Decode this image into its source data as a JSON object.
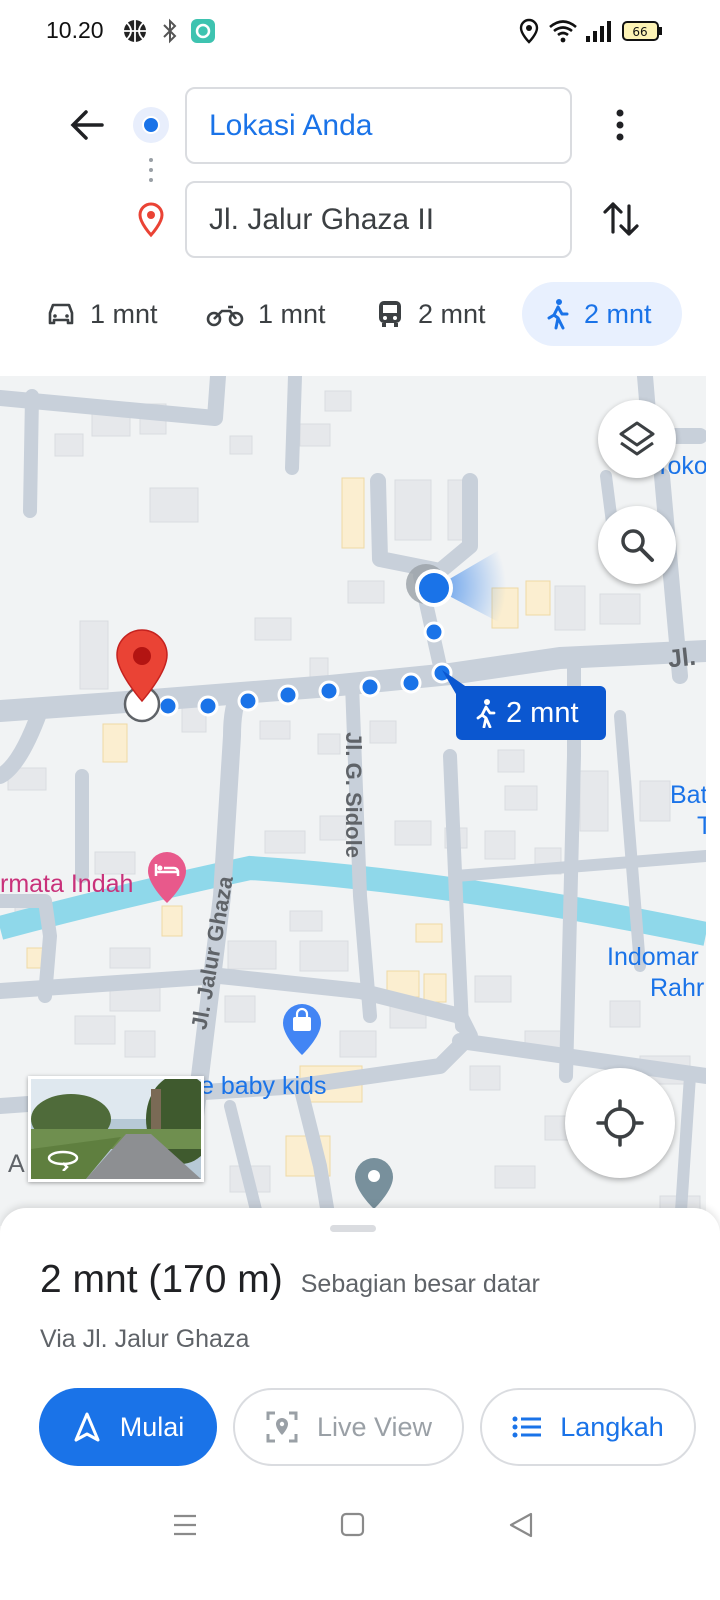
{
  "status_bar": {
    "time": "10.20",
    "battery": "66",
    "left_icons": [
      "basketball-icon",
      "bluetooth-icon",
      "app-notification-icon"
    ],
    "right_icons": [
      "location-icon",
      "wifi-icon",
      "signal-icon",
      "battery-icon"
    ]
  },
  "directions": {
    "origin": "Lokasi Anda",
    "destination": "Jl. Jalur Ghaza II"
  },
  "modes": [
    {
      "icon": "car-icon",
      "time": "1 mnt"
    },
    {
      "icon": "motorcycle-icon",
      "time": "1 mnt"
    },
    {
      "icon": "transit-icon",
      "time": "2 mnt"
    },
    {
      "icon": "walk-icon",
      "time": "2 mnt",
      "selected": true
    }
  ],
  "map": {
    "route_badge": "2 mnt",
    "labels": {
      "toko": "Toko",
      "jl_right": "Jl.",
      "jl_g_sidole": "Jl. G. Sidole",
      "jl_jalur_ghaza": "Jl. Jalur Ghaza",
      "permata_indah": "rmata Indah",
      "bat": "Bat",
      "t": "T",
      "indomaret": "Indomar",
      "rahm": "Rahr",
      "baby_kids": "e baby kids",
      "a": "A"
    }
  },
  "sheet": {
    "summary_main": "2 mnt (170 m)",
    "summary_note": "Sebagian besar datar",
    "via": "Via Jl. Jalur Ghaza",
    "start_label": "Mulai",
    "live_view_label": "Live View",
    "steps_label": "Langkah"
  },
  "colors": {
    "accent": "#1a73e8",
    "route_badge": "#0b57d0",
    "destination_pin": "#ea4335",
    "river": "#8fd8ea",
    "road": "#c8d0da",
    "map_background": "#f1f3f4"
  }
}
